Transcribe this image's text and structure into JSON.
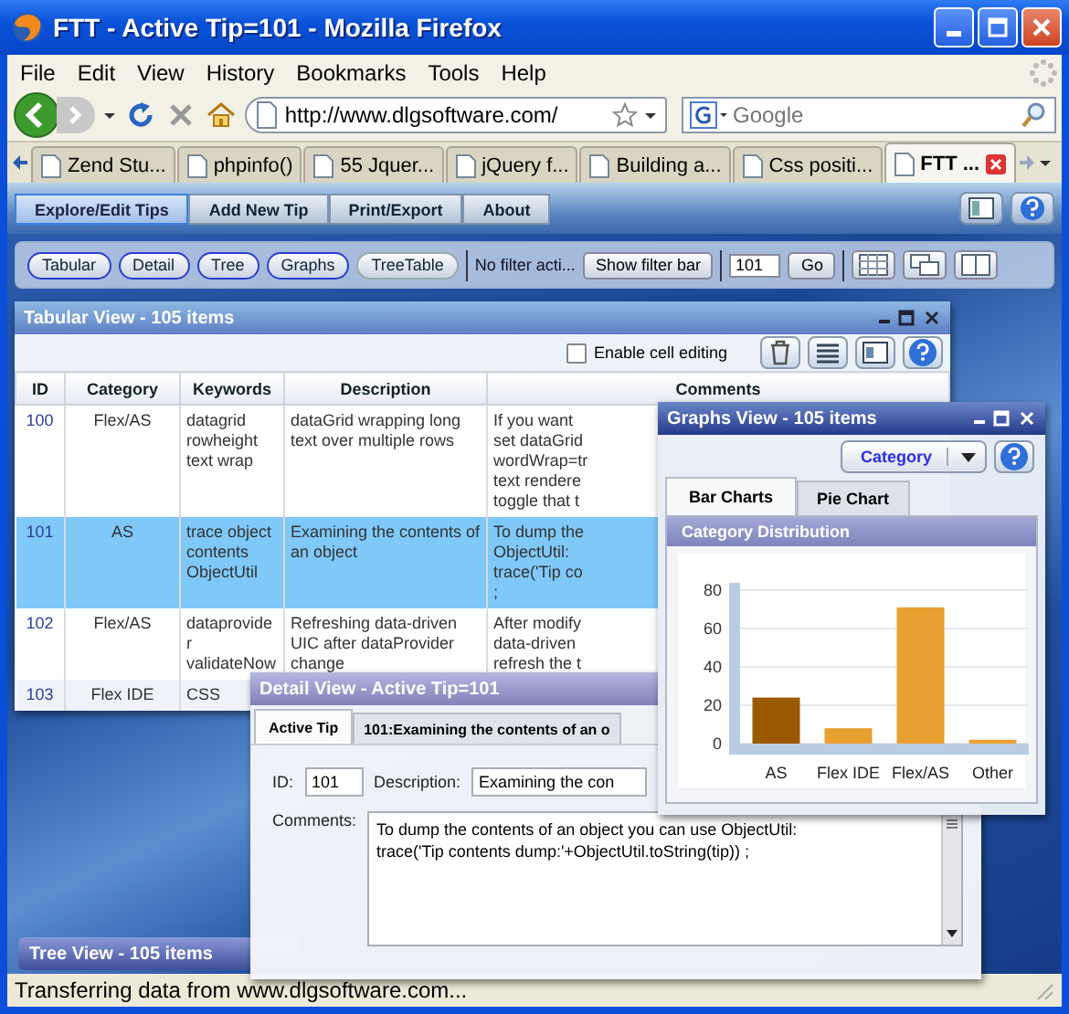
{
  "window": {
    "title": "FTT - Active Tip=101 - Mozilla Firefox"
  },
  "menu": [
    "File",
    "Edit",
    "View",
    "History",
    "Bookmarks",
    "Tools",
    "Help"
  ],
  "address_bar": {
    "url": "http://www.dlgsoftware.com/"
  },
  "search": {
    "placeholder": "Google"
  },
  "browser_tabs": [
    {
      "label": "Zend Stu...",
      "selected": false
    },
    {
      "label": "phpinfo()",
      "selected": false
    },
    {
      "label": "55 Jquer...",
      "selected": false
    },
    {
      "label": "jQuery f...",
      "selected": false
    },
    {
      "label": "Building a...",
      "selected": false
    },
    {
      "label": "Css positi...",
      "selected": false
    },
    {
      "label": "FTT ...",
      "selected": true
    }
  ],
  "app_nav": [
    {
      "label": "Explore/Edit Tips",
      "selected": true
    },
    {
      "label": "Add New Tip",
      "selected": false
    },
    {
      "label": "Print/Export",
      "selected": false
    },
    {
      "label": "About",
      "selected": false
    }
  ],
  "view_buttons": [
    {
      "label": "Tabular",
      "on": true
    },
    {
      "label": "Detail",
      "on": true
    },
    {
      "label": "Tree",
      "on": true
    },
    {
      "label": "Graphs",
      "on": true
    },
    {
      "label": "TreeTable",
      "on": false
    }
  ],
  "filter": {
    "status": "No filter acti...",
    "button": "Show filter bar"
  },
  "goto": {
    "value": "101",
    "button": "Go"
  },
  "tabular_window": {
    "title": "Tabular View - 105 items",
    "cell_editing": {
      "label": "Enable cell editing",
      "checked": false
    },
    "columns": [
      "ID",
      "Category",
      "Keywords",
      "Description",
      "Comments"
    ],
    "rows": [
      {
        "id": "100",
        "category": "Flex/AS",
        "keywords": "datagrid rowheight text wrap",
        "description": "dataGrid wrapping long text over multiple rows",
        "comments": "If you want\nset dataGrid\nwordWrap=tr\ntext rendere\ntoggle that t",
        "selected": false
      },
      {
        "id": "101",
        "category": "AS",
        "keywords": "trace object contents ObjectUtil",
        "description": "Examining the contents of an object",
        "comments": "To dump the\nObjectUtil:\ntrace('Tip co\n;",
        "selected": true
      },
      {
        "id": "102",
        "category": "Flex/AS",
        "keywords": "dataprovide\nr\nvalidateNow",
        "description": "Refreshing data-driven UIC after dataProvider change",
        "comments": "After modify\ndata-driven\nrefresh the t",
        "selected": false
      },
      {
        "id": "103",
        "category": "Flex IDE",
        "keywords": "CSS",
        "selected": false
      }
    ]
  },
  "graphs_window": {
    "title": "Graphs View - 105 items",
    "group_by": "Category",
    "tabs": [
      {
        "label": "Bar Charts",
        "selected": true
      },
      {
        "label": "Pie Chart",
        "selected": false
      }
    ],
    "chart_data": {
      "type": "bar",
      "title": "Category Distribution",
      "categories": [
        "AS",
        "Flex IDE",
        "Flex/AS",
        "Other"
      ],
      "series": [
        {
          "color": "#9b5a00",
          "values": [
            24,
            null,
            null,
            null
          ]
        },
        {
          "color": "#e8a030",
          "values": [
            null,
            8,
            71,
            2
          ]
        }
      ],
      "stacked": true,
      "grid": true,
      "ylim": [
        0,
        80
      ],
      "yticks": [
        0,
        20,
        40,
        60,
        80
      ]
    }
  },
  "detail_window": {
    "title": "Detail View - Active Tip=101",
    "tabs": [
      {
        "label": "Active Tip",
        "selected": true
      },
      {
        "label": "101:Examining the contents of an o",
        "selected": false
      }
    ],
    "id_label": "ID:",
    "id_value": "101",
    "description_label": "Description:",
    "description_value": "Examining the con",
    "comments_label": "Comments:",
    "comments_value": "To dump the contents of an object you can use ObjectUtil:\ntrace('Tip contents dump:'+ObjectUtil.toString(tip)) ;"
  },
  "tree_window": {
    "title": "Tree View - 105 items"
  },
  "status_bar": {
    "text": "Transferring data from www.dlgsoftware.com..."
  }
}
